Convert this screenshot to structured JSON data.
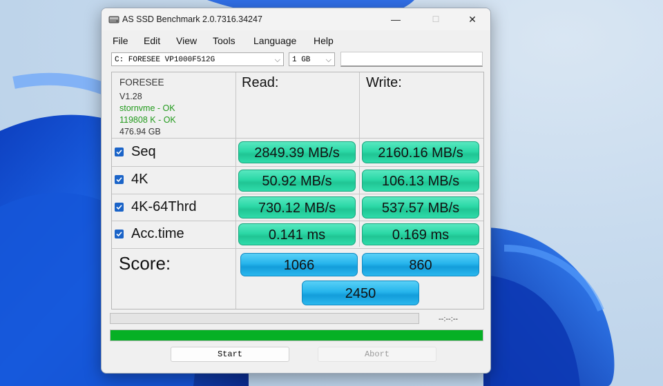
{
  "window": {
    "title": "AS SSD Benchmark 2.0.7316.34247",
    "minimize_glyph": "—",
    "maximize_glyph": "☐",
    "close_glyph": "✕"
  },
  "menu": [
    "File",
    "Edit",
    "View",
    "Tools",
    "Language",
    "Help"
  ],
  "drive_select": {
    "value": "C: FORESEE VP1000F512G",
    "arrow": "⌵"
  },
  "size_select": {
    "value": "1 GB",
    "arrow": "⌵"
  },
  "drive_info": {
    "model": "FORESEE",
    "firmware": "V1.28",
    "driver": "stornvme - OK",
    "alignment": "119808 K - OK",
    "capacity": "476.94 GB"
  },
  "headers": {
    "read": "Read:",
    "write": "Write:"
  },
  "tests": [
    {
      "label": "Seq",
      "checked": true,
      "read": "2849.39 MB/s",
      "write": "2160.16 MB/s"
    },
    {
      "label": "4K",
      "checked": true,
      "read": "50.92 MB/s",
      "write": "106.13 MB/s"
    },
    {
      "label": "4K-64Thrd",
      "checked": true,
      "read": "730.12 MB/s",
      "write": "537.57 MB/s"
    },
    {
      "label": "Acc.time",
      "checked": true,
      "read": "0.141 ms",
      "write": "0.169 ms"
    }
  ],
  "score": {
    "label": "Score:",
    "read": "1066",
    "write": "860",
    "total": "2450"
  },
  "status": {
    "time": "--:--:--",
    "overall_progress": 1.0
  },
  "buttons": {
    "start": "Start",
    "abort": "Abort"
  },
  "colors": {
    "result_green": "#2bd8a6",
    "score_blue": "#26b5ec",
    "progress_green": "#06b025",
    "check_blue": "#1b64c8"
  },
  "icons": {
    "app": "hard-drive-icon",
    "checkbox": "checkmark-icon"
  }
}
